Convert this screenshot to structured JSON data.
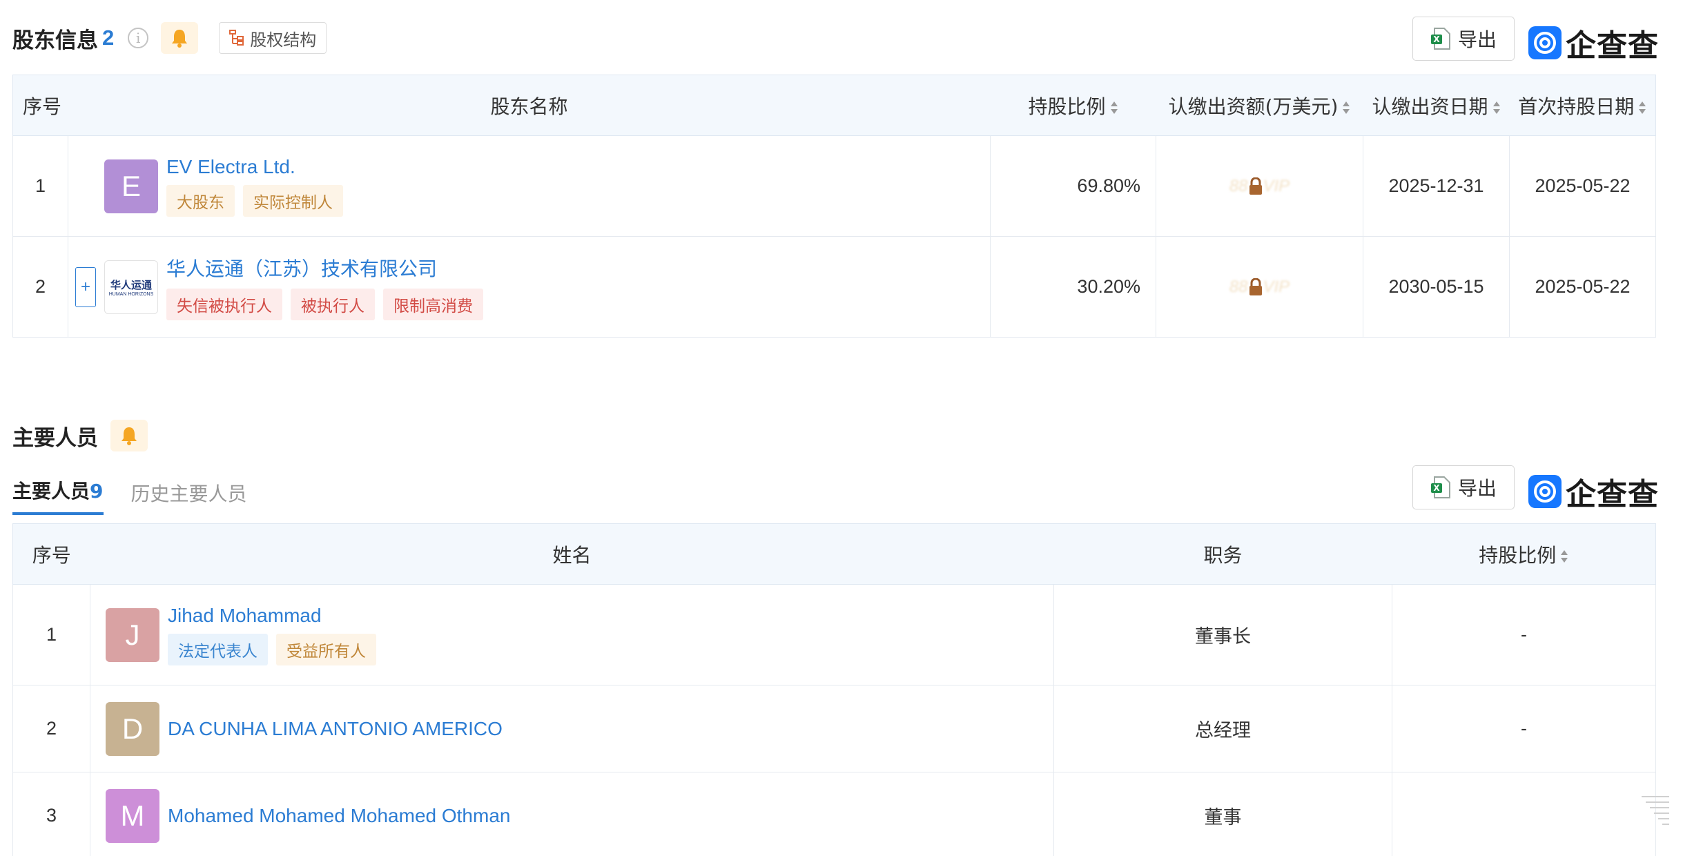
{
  "shareholders": {
    "title": "股东信息",
    "count": "2",
    "info_icon": "i",
    "equity_button": "股权结构",
    "export_label": "导出",
    "logo_text": "企查查",
    "headers": [
      "序号",
      "股东名称",
      "持股比例",
      "认缴出资额(万美元)",
      "认缴出资日期",
      "首次持股日期"
    ],
    "rows": [
      {
        "index": "1",
        "avatar_letter": "E",
        "avatar_color": "#b28fd6",
        "name": "EV Electra Ltd.",
        "tags": [
          "大股东",
          "实际控制人"
        ],
        "ratio": "69.80%",
        "capital": "VIP",
        "subscribe_date": "2025-12-31",
        "first_date": "2025-05-22"
      },
      {
        "index": "2",
        "expand": "+",
        "logo_cn": "华人运通",
        "logo_en": "HUMAN HORIZONS",
        "name": "华人运通（江苏）技术有限公司",
        "tags": [
          "失信被执行人",
          "被执行人",
          "限制高消费"
        ],
        "ratio": "30.20%",
        "capital": "VIP",
        "subscribe_date": "2030-05-15",
        "first_date": "2025-05-22"
      }
    ]
  },
  "personnel": {
    "title": "主要人员",
    "tab_active_label": "主要人员",
    "tab_active_count": "9",
    "tab_inactive_label": "历史主要人员",
    "export_label": "导出",
    "logo_text": "企查查",
    "headers": [
      "序号",
      "姓名",
      "职务",
      "持股比例"
    ],
    "rows": [
      {
        "index": "1",
        "avatar_letter": "J",
        "avatar_color": "#d9a2a3",
        "name": "Jihad Mohammad",
        "tags": [
          "法定代表人",
          "受益所有人"
        ],
        "position": "董事长",
        "ratio": "-"
      },
      {
        "index": "2",
        "avatar_letter": "D",
        "avatar_color": "#c7b292",
        "name": "DA CUNHA LIMA ANTONIO AMERICO",
        "tags": [],
        "position": "总经理",
        "ratio": "-"
      },
      {
        "index": "3",
        "avatar_letter": "M",
        "avatar_color": "#cd8fd8",
        "name": "Mohamed Mohamed Mohamed Othman",
        "tags": [],
        "position": "董事",
        "ratio": ""
      }
    ]
  },
  "colors": {
    "link": "#2b7cd3",
    "header_bg": "#f3f8fd",
    "bell": "#f5a623"
  }
}
